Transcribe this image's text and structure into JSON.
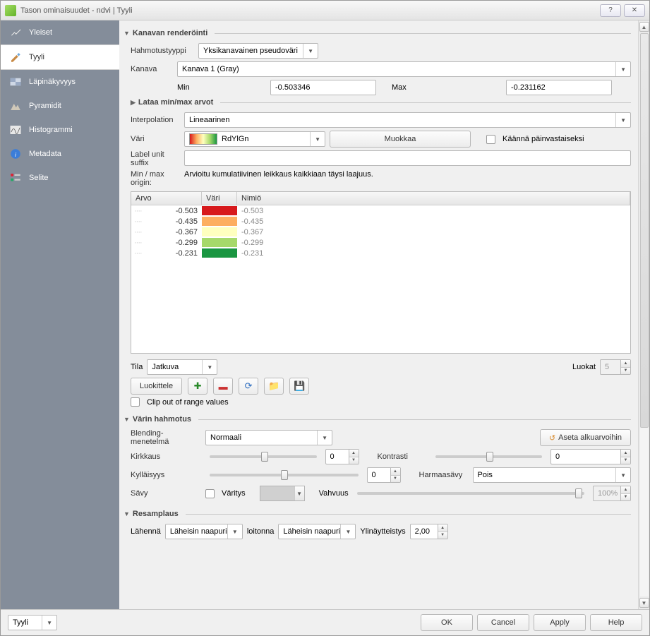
{
  "window": {
    "title": "Tason ominaisuudet - ndvi | Tyyli"
  },
  "sidebar": {
    "items": [
      {
        "label": "Yleiset"
      },
      {
        "label": "Tyyli"
      },
      {
        "label": "Läpinäkyvyys"
      },
      {
        "label": "Pyramidit"
      },
      {
        "label": "Histogrammi"
      },
      {
        "label": "Metadata"
      },
      {
        "label": "Selite"
      }
    ]
  },
  "render": {
    "section": "Kanavan renderöinti",
    "hahmo_label": "Hahmotustyyppi",
    "hahmo": "Yksikanavainen pseudoväri",
    "kanava_label": "Kanava",
    "kanava": "Kanava 1 (Gray)",
    "min_label": "Min",
    "min": "-0.503346",
    "max_label": "Max",
    "max": "-0.231162",
    "lataa": "Lataa min/max arvot",
    "interp_label": "Interpolation",
    "interp": "Lineaarinen",
    "vari_label": "Väri",
    "ramp": "RdYlGn",
    "muokkaa": "Muokkaa",
    "invert": "Käännä päinvastaiseksi",
    "suffix_label": "Label unit suffix",
    "suffix": "",
    "origin_label": "Min / max origin:",
    "origin_text": "Arvioitu kumulatiivinen leikkaus kaikkiaan täysi laajuus.",
    "cols": {
      "arvo": "Arvo",
      "vari": "Väri",
      "nimio": "Nimiö"
    },
    "rows": [
      {
        "arvo": "-0.503",
        "color": "#d7191c",
        "nimio": "-0.503"
      },
      {
        "arvo": "-0.435",
        "color": "#fdae61",
        "nimio": "-0.435"
      },
      {
        "arvo": "-0.367",
        "color": "#ffffbf",
        "nimio": "-0.367"
      },
      {
        "arvo": "-0.299",
        "color": "#a6d96a",
        "nimio": "-0.299"
      },
      {
        "arvo": "-0.231",
        "color": "#1a9641",
        "nimio": "-0.231"
      }
    ],
    "tila_label": "Tila",
    "tila": "Jatkuva",
    "luokat_label": "Luokat",
    "luokat": "5",
    "luokittele": "Luokittele",
    "clip": "Clip out of range values"
  },
  "color": {
    "section": "Värin hahmotus",
    "blend_label": "Blending-menetelmä",
    "blend": "Normaali",
    "reset": "Aseta alkuarvoihin",
    "kirkkaus_label": "Kirkkaus",
    "kirkkaus": "0",
    "kontrasti_label": "Kontrasti",
    "kontrasti": "0",
    "kyll_label": "Kylläisyys",
    "kyll": "0",
    "harmaa_label": "Harmaasävy",
    "harmaa": "Pois",
    "savy_label": "Sävy",
    "varitys": "Väritys",
    "vahvuus_label": "Vahvuus",
    "vahvuus": "100%"
  },
  "resamp": {
    "section": "Resamplaus",
    "lahenna_label": "Lähennä",
    "lahenna": "Läheisin naapuri",
    "loitonna_label": "loitonna",
    "loitonna": "Läheisin naapuri",
    "yli_label": "Ylinäytteistys",
    "yli": "2,00"
  },
  "bottom": {
    "tyyli": "Tyyli",
    "ok": "OK",
    "cancel": "Cancel",
    "apply": "Apply",
    "help": "Help"
  }
}
